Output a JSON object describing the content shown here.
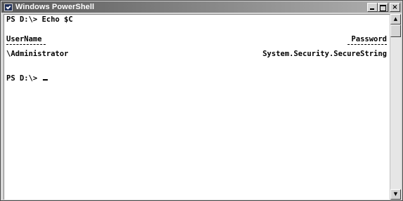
{
  "window": {
    "title": "Windows PowerShell",
    "icon": "powershell-icon"
  },
  "caption_buttons": {
    "minimize_icon": "minimize-icon",
    "maximize_icon": "maximize-icon",
    "close_glyph": "×"
  },
  "console": {
    "command_line": "PS D:\\> Echo $C",
    "table": {
      "headers": [
        "UserName",
        "Password"
      ],
      "rows": [
        [
          "\\Administrator",
          "System.Security.SecureString"
        ]
      ]
    },
    "prompt": "PS D:\\> "
  },
  "scrollbar": {
    "up_glyph": "▲",
    "down_glyph": "▼"
  }
}
